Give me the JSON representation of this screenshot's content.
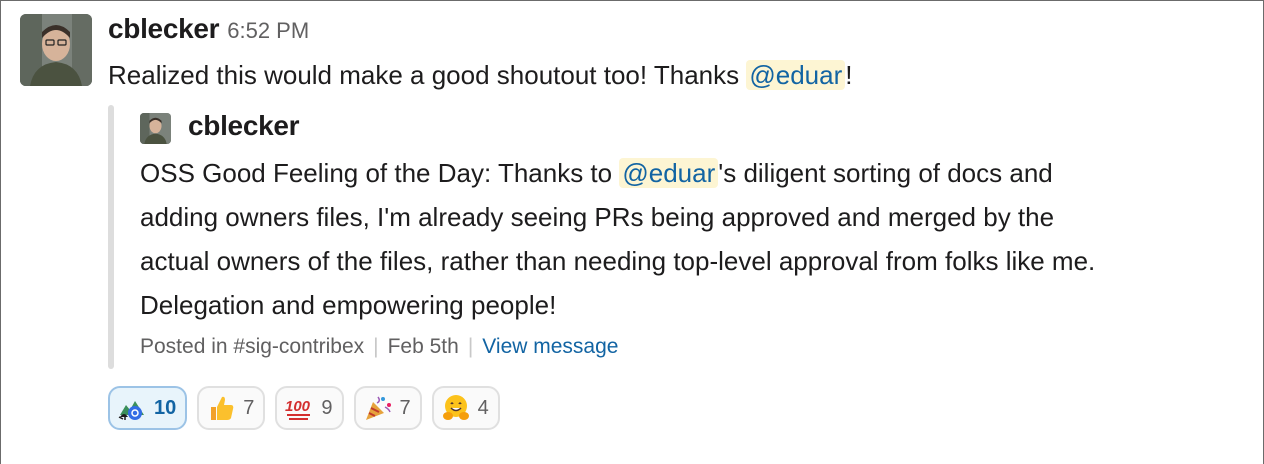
{
  "message": {
    "username": "cblecker",
    "time": "6:52 PM",
    "text_before": "Realized this would make a good shoutout too! Thanks ",
    "mention": "@eduar",
    "text_after": "!"
  },
  "quote": {
    "author": "cblecker",
    "line1_before": "OSS Good Feeling of the Day: Thanks to ",
    "line1_mention": "@eduar",
    "line1_after": "'s diligent sorting of docs and",
    "line2": "adding owners files, I'm already seeing PRs being approved and merged by the",
    "line3": "actual owners of the files, rather than needing top-level approval from folks like me.",
    "line4": "Delegation and empowering people!",
    "posted_in": "Posted in #sig-contribex",
    "date": "Feb 5th",
    "view_link": "View message"
  },
  "reactions": [
    {
      "icon": "custom-contribex-icon",
      "count": "10",
      "active": true
    },
    {
      "icon": "thumbs-up-icon",
      "count": "7",
      "active": false
    },
    {
      "icon": "hundred-points-icon",
      "count": "9",
      "active": false
    },
    {
      "icon": "party-popper-icon",
      "count": "7",
      "active": false
    },
    {
      "icon": "hugging-face-icon",
      "count": "4",
      "active": false
    }
  ],
  "colors": {
    "mention_bg": "#fdf5d3",
    "link": "#1264a3",
    "quote_bar": "#dddddd",
    "active_reaction_bg": "#e8f4fb"
  }
}
